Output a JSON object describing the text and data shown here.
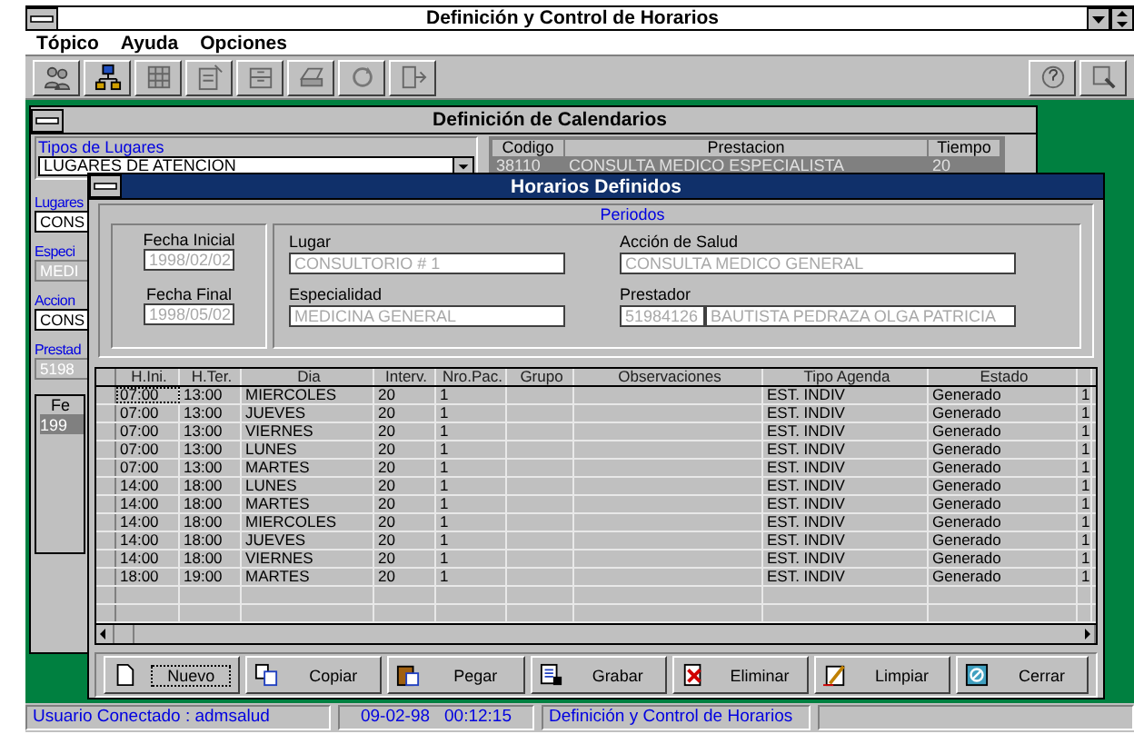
{
  "window": {
    "title": "Definición y Control de Horarios"
  },
  "menu": [
    "Tópico",
    "Ayuda",
    "Opciones"
  ],
  "calendar_window": {
    "title": "Definición de Calendarios",
    "tipos_label": "Tipos de Lugares",
    "tipos_value": "LUGARES DE ATENCION",
    "table": {
      "columns": [
        "Codigo",
        "Prestacion",
        "Tiempo"
      ],
      "rows": [
        [
          "38110",
          "CONSULTA MEDICO ESPECIALISTA",
          "20"
        ]
      ]
    },
    "left_items": [
      {
        "kind": "label",
        "text": "Lugares"
      },
      {
        "kind": "field",
        "text": "CONS"
      },
      {
        "kind": "label",
        "text": "Especi"
      },
      {
        "kind": "field",
        "text": "MEDI"
      },
      {
        "kind": "label",
        "text": "Accion"
      },
      {
        "kind": "field",
        "text": "CONS"
      },
      {
        "kind": "label",
        "text": "Prestad"
      },
      {
        "kind": "field",
        "text": "5198"
      }
    ],
    "grid": {
      "header": "Fe",
      "rows": [
        "199"
      ]
    }
  },
  "dialog": {
    "title": "Horarios Definidos",
    "group_label": "Periodos",
    "fecha_inicial": {
      "label": "Fecha Inicial",
      "value": "1998/02/02"
    },
    "fecha_final": {
      "label": "Fecha Final",
      "value": "1998/05/02"
    },
    "lugar": {
      "label": "Lugar",
      "value": "CONSULTORIO # 1"
    },
    "especialidad": {
      "label": "Especialidad",
      "value": "MEDICINA GENERAL"
    },
    "accion": {
      "label": "Acción de Salud",
      "value": "CONSULTA MEDICO GENERAL"
    },
    "prestador": {
      "label": "Prestador",
      "code": "51984126",
      "name": "BAUTISTA PEDRAZA OLGA PATRICIA"
    },
    "columns": [
      "H.Ini.",
      "H.Ter.",
      "Dia",
      "Interv.",
      "Nro.Pac.",
      "Grupo",
      "Observaciones",
      "Tipo Agenda",
      "Estado"
    ],
    "rows": [
      {
        "focused": true,
        "cells": [
          "07:00",
          "13:00",
          "MIERCOLES",
          "20",
          "1",
          "",
          "",
          "EST. INDIV",
          "Generado",
          "1"
        ]
      },
      {
        "focused": false,
        "cells": [
          "07:00",
          "13:00",
          "JUEVES",
          "20",
          "1",
          "",
          "",
          "EST. INDIV",
          "Generado",
          "1"
        ]
      },
      {
        "focused": false,
        "cells": [
          "07:00",
          "13:00",
          "VIERNES",
          "20",
          "1",
          "",
          "",
          "EST. INDIV",
          "Generado",
          "1"
        ]
      },
      {
        "focused": false,
        "cells": [
          "07:00",
          "13:00",
          "LUNES",
          "20",
          "1",
          "",
          "",
          "EST. INDIV",
          "Generado",
          "1"
        ]
      },
      {
        "focused": false,
        "cells": [
          "07:00",
          "13:00",
          "MARTES",
          "20",
          "1",
          "",
          "",
          "EST. INDIV",
          "Generado",
          "1"
        ]
      },
      {
        "focused": false,
        "cells": [
          "14:00",
          "18:00",
          "LUNES",
          "20",
          "1",
          "",
          "",
          "EST. INDIV",
          "Generado",
          "1"
        ]
      },
      {
        "focused": false,
        "cells": [
          "14:00",
          "18:00",
          "MARTES",
          "20",
          "1",
          "",
          "",
          "EST. INDIV",
          "Generado",
          "1"
        ]
      },
      {
        "focused": false,
        "cells": [
          "14:00",
          "18:00",
          "MIERCOLES",
          "20",
          "1",
          "",
          "",
          "EST. INDIV",
          "Generado",
          "1"
        ]
      },
      {
        "focused": false,
        "cells": [
          "14:00",
          "18:00",
          "JUEVES",
          "20",
          "1",
          "",
          "",
          "EST. INDIV",
          "Generado",
          "1"
        ]
      },
      {
        "focused": false,
        "cells": [
          "14:00",
          "18:00",
          "VIERNES",
          "20",
          "1",
          "",
          "",
          "EST. INDIV",
          "Generado",
          "1"
        ]
      },
      {
        "focused": false,
        "cells": [
          "18:00",
          "19:00",
          "MARTES",
          "20",
          "1",
          "",
          "",
          "EST. INDIV",
          "Generado",
          "1"
        ]
      }
    ],
    "buttons": [
      {
        "label": "Nuevo",
        "focused": true
      },
      {
        "label": "Copiar",
        "focused": false
      },
      {
        "label": "Pegar",
        "focused": false
      },
      {
        "label": "Grabar",
        "focused": false
      },
      {
        "label": "Eliminar",
        "focused": false
      },
      {
        "label": "Limpiar",
        "focused": false
      },
      {
        "label": "Cerrar",
        "focused": false
      }
    ]
  },
  "status_bar": {
    "user": "Usuario Conectado : admsalud",
    "date": "09-02-98",
    "time": "00:12:15",
    "message": "Definición y Control de Horarios"
  }
}
